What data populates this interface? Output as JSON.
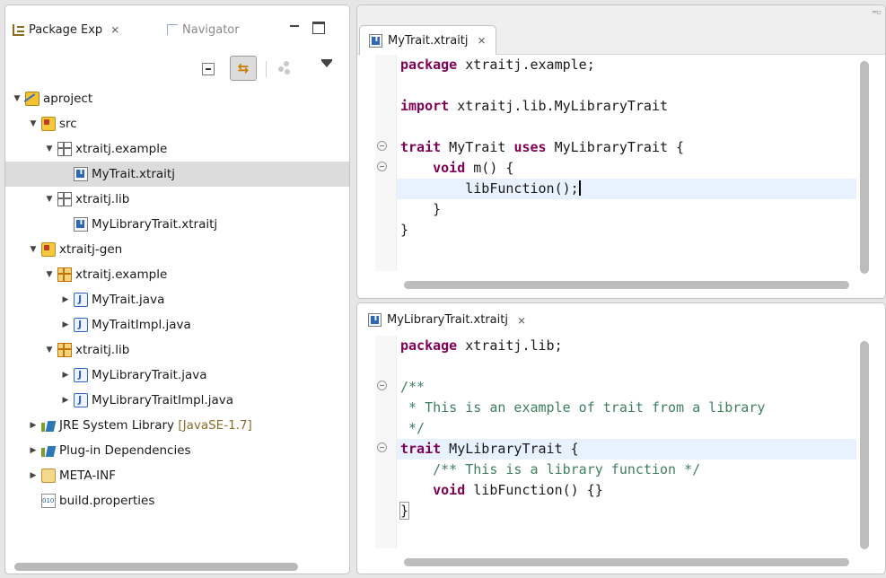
{
  "package_explorer": {
    "tab_label": "Package Exp",
    "navigator_label": "Navigator",
    "tree": [
      {
        "label": "aproject",
        "depth": 0,
        "expanded": true,
        "icon": "project-icon"
      },
      {
        "label": "src",
        "depth": 1,
        "expanded": true,
        "icon": "source-folder-icon"
      },
      {
        "label": "xtraitj.example",
        "depth": 2,
        "expanded": true,
        "icon": "package-icon"
      },
      {
        "label": "MyTrait.xtraitj",
        "depth": 3,
        "selected": true,
        "icon": "xtraitj-file-icon"
      },
      {
        "label": "xtraitj.lib",
        "depth": 2,
        "expanded": true,
        "icon": "package-icon"
      },
      {
        "label": "MyLibraryTrait.xtraitj",
        "depth": 3,
        "icon": "xtraitj-file-icon"
      },
      {
        "label": "xtraitj-gen",
        "depth": 1,
        "expanded": true,
        "icon": "source-folder-icon"
      },
      {
        "label": "xtraitj.example",
        "depth": 2,
        "expanded": true,
        "icon": "generated-package-icon"
      },
      {
        "label": "MyTrait.java",
        "depth": 3,
        "expanded": false,
        "icon": "java-file-icon"
      },
      {
        "label": "MyTraitImpl.java",
        "depth": 3,
        "expanded": false,
        "icon": "java-file-icon"
      },
      {
        "label": "xtraitj.lib",
        "depth": 2,
        "expanded": true,
        "icon": "generated-package-icon"
      },
      {
        "label": "MyLibraryTrait.java",
        "depth": 3,
        "expanded": false,
        "icon": "java-file-icon"
      },
      {
        "label": "MyLibraryTraitImpl.java",
        "depth": 3,
        "expanded": false,
        "icon": "java-file-icon"
      },
      {
        "label": "JRE System Library",
        "suffix": "[JavaSE-1.7]",
        "depth": 1,
        "expanded": false,
        "icon": "library-icon"
      },
      {
        "label": "Plug-in Dependencies",
        "depth": 1,
        "expanded": false,
        "icon": "library-icon"
      },
      {
        "label": "META-INF",
        "depth": 1,
        "expanded": false,
        "icon": "folder-icon"
      },
      {
        "label": "build.properties",
        "depth": 1,
        "icon": "properties-file-icon"
      }
    ]
  },
  "editors": [
    {
      "tab_label": "MyTrait.xtraitj",
      "current_line": 5,
      "lines": [
        {
          "tokens": [
            {
              "t": "package",
              "k": "kw"
            },
            {
              "t": " xtraitj.example;"
            }
          ]
        },
        {
          "tokens": []
        },
        {
          "tokens": [
            {
              "t": "import",
              "k": "kw"
            },
            {
              "t": " xtraitj.lib.MyLibraryTrait"
            }
          ]
        },
        {
          "tokens": []
        },
        {
          "fold": true,
          "tokens": [
            {
              "t": "trait",
              "k": "kw"
            },
            {
              "t": " MyTrait "
            },
            {
              "t": "uses",
              "k": "kw"
            },
            {
              "t": " MyLibraryTrait {"
            }
          ]
        },
        {
          "fold": true,
          "tokens": [
            {
              "t": "    "
            },
            {
              "t": "void",
              "k": "kw"
            },
            {
              "t": " m() {"
            }
          ]
        },
        {
          "caret": true,
          "tokens": [
            {
              "t": "        libFunction();"
            }
          ]
        },
        {
          "tokens": [
            {
              "t": "    }"
            }
          ]
        },
        {
          "tokens": [
            {
              "t": "}"
            }
          ]
        }
      ]
    },
    {
      "tab_label": "MyLibraryTrait.xtraitj",
      "current_line": 4,
      "lines": [
        {
          "tokens": [
            {
              "t": "package",
              "k": "kw"
            },
            {
              "t": " xtraitj.lib;"
            }
          ]
        },
        {
          "tokens": []
        },
        {
          "fold": true,
          "tokens": [
            {
              "t": "/**",
              "k": "cm"
            }
          ]
        },
        {
          "tokens": [
            {
              "t": " * This is an example of trait from a library",
              "k": "cm"
            }
          ]
        },
        {
          "tokens": [
            {
              "t": " */",
              "k": "cm"
            }
          ]
        },
        {
          "fold": true,
          "tokens": [
            {
              "t": "trait",
              "k": "kw"
            },
            {
              "t": " MyLibraryTrait {"
            }
          ]
        },
        {
          "tokens": [
            {
              "t": "    "
            },
            {
              "t": "/** This is a library function */",
              "k": "cm"
            }
          ]
        },
        {
          "tokens": [
            {
              "t": "    "
            },
            {
              "t": "void",
              "k": "kw"
            },
            {
              "t": " libFunction() {}"
            }
          ]
        },
        {
          "bracket": true,
          "tokens": [
            {
              "t": "}"
            }
          ]
        }
      ]
    }
  ]
}
